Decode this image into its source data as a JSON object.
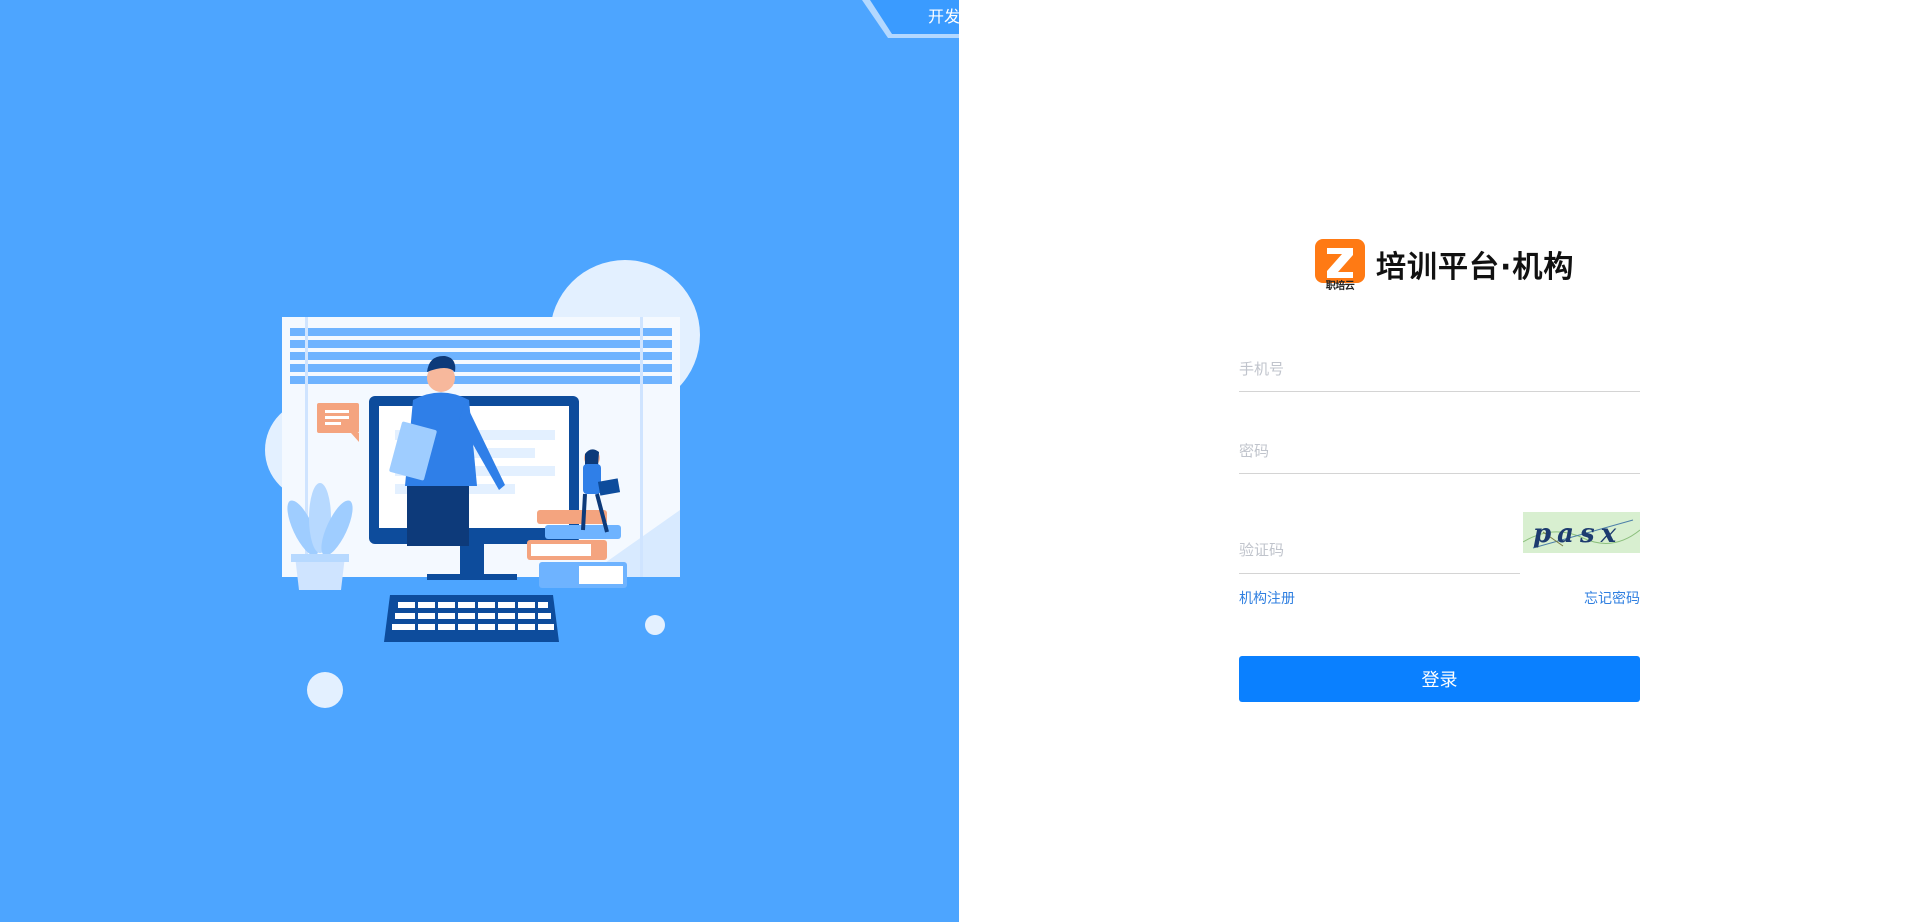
{
  "environment_badge": {
    "label": "开发环境"
  },
  "brand": {
    "logo_text": "职培云",
    "title": "培训平台·机构"
  },
  "form": {
    "phone": {
      "placeholder": "手机号",
      "value": ""
    },
    "password": {
      "placeholder": "密码",
      "value": ""
    },
    "captcha": {
      "placeholder": "验证码",
      "value": "",
      "image_text": "pasx"
    },
    "register_link": "机构注册",
    "forgot_link": "忘记密码",
    "login_button": "登录"
  },
  "colors": {
    "left_panel": "#4da5ff",
    "primary_button": "#0a80ff",
    "link": "#2f7fe0",
    "logo_orange": "#ff7a14"
  }
}
